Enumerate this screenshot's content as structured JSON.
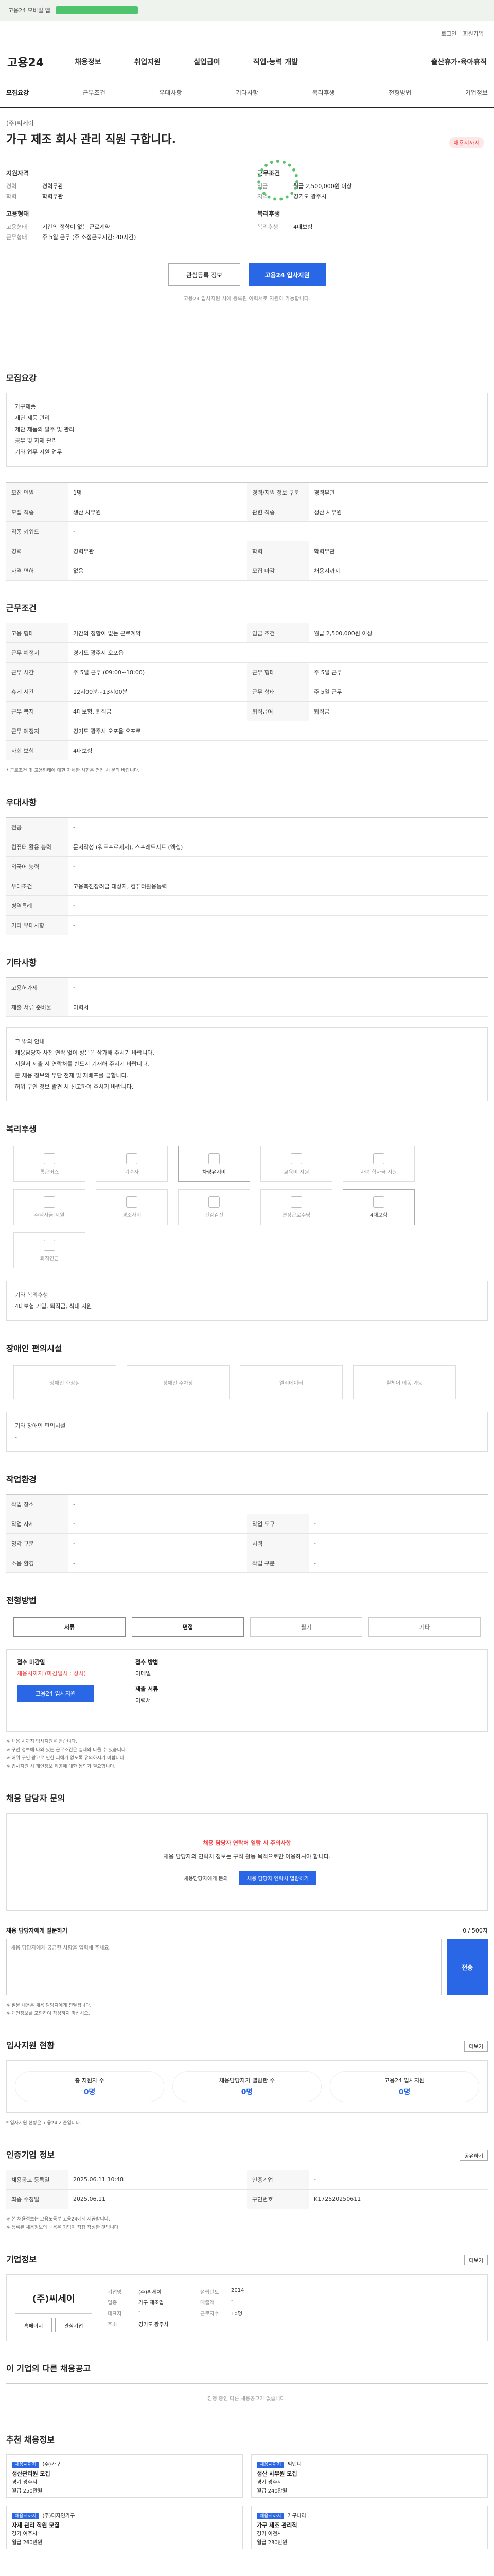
{
  "top": {
    "banner_text": "고용24 모바일 앱",
    "bar_label": "앱 다운로드"
  },
  "util": {
    "login": "로그인",
    "signup": "회원가입"
  },
  "gnb": {
    "logo": "고용24",
    "menu": [
      "채용정보",
      "취업지원",
      "실업급여",
      "직업·능력 개발"
    ],
    "right": "출산휴가·육아휴직"
  },
  "tabs": [
    "모집요강",
    "근무조건",
    "우대사항",
    "기타사항",
    "복리후생",
    "전형방법",
    "기업정보"
  ],
  "job": {
    "company": "(주)씨세이",
    "title": "가구 제조 회사 관리 직원 구합니다.",
    "dday": "채용시까지",
    "left_title": "지원자격",
    "left_rows": [
      [
        "경력",
        "경력무관"
      ],
      [
        "학력",
        "학력무관"
      ]
    ],
    "left_title2": "고용형태",
    "left_rows2": [
      [
        "고용형태",
        "기간의 정함이 없는 근로계약"
      ],
      [
        "근무형태",
        "주 5일 근무 (주 소정근로시간: 40시간)"
      ]
    ],
    "right_title": "근무조건",
    "right_rows": [
      [
        "임금",
        "월급 2,500,000원 이상"
      ],
      [
        "지역",
        "경기도 광주시"
      ]
    ],
    "right_title2": "복리후생",
    "right_rows2": [
      [
        "복리후생",
        "4대보험"
      ]
    ],
    "btn_save": "관심등록 정보",
    "btn_apply": "고용24 입사지원",
    "note": "고용24 입사지원 시에 등록된 이력서로 지원이 가능합니다."
  },
  "recruit": {
    "h": "모집요강",
    "desc": [
      "가구제품",
      "재단 제품 관리",
      "제단 제품의 발주 및 관리",
      "공무 및 자재 관리",
      "기타 업무 지원 업무"
    ],
    "rows": [
      [
        "모집 인원",
        "1명",
        "경력/지원 정보 구분",
        "경력무관"
      ],
      [
        "모집 직종",
        "생산 사무원",
        "관련 직종",
        "생산 사무원"
      ],
      [
        "직종 키워드",
        "-",
        "",
        ""
      ],
      [
        "경력",
        "경력무관",
        "학력",
        "학력무관"
      ],
      [
        "자격 면허",
        "없음",
        "모집 마감",
        "채용시까지"
      ]
    ]
  },
  "work": {
    "h": "근무조건",
    "rows": [
      [
        "고용 형태",
        "기간의 정함이 없는 근로계약",
        "임금 조건",
        "월급 2,500,000원 이상"
      ],
      [
        "근무 예정지",
        "경기도 광주시 오포읍",
        "",
        ""
      ],
      [
        "근무 시간",
        "주 5일 근무 (09:00~18:00)",
        "근무 형태",
        "주 5일 근무"
      ],
      [
        "휴게 시간",
        "12시00분~13시00분",
        "근무 형태",
        "주 5일 근무"
      ],
      [
        "근무 복지",
        "4대보험, 퇴직금",
        "퇴직급여",
        "퇴직금"
      ],
      [
        "근무 예정지",
        "경기도 광주시 오포읍 오포로",
        "",
        ""
      ],
      [
        "사회 보험",
        "4대보험",
        "",
        ""
      ]
    ],
    "note": "* 근로조건 및 고용형태에 대한 자세한 사항은 면접 시 문의 바랍니다."
  },
  "prefer": {
    "h": "우대사항",
    "rows": [
      [
        "전공",
        "-"
      ],
      [
        "컴퓨터 활용 능력",
        "문서작성 (워드프로세서), 스프레드시트 (엑셀)"
      ],
      [
        "외국어 능력",
        "-"
      ],
      [
        "우대조건",
        "고용촉진장려금 대상자, 컴퓨터활용능력"
      ],
      [
        "병역특례",
        "-"
      ],
      [
        "기타 우대사항",
        "-"
      ]
    ]
  },
  "etc": {
    "h": "기타사항",
    "rows": [
      [
        "고용허가제",
        "-"
      ],
      [
        "제출 서류 준비물",
        "이력서"
      ]
    ],
    "notice_title": "그 밖의 안내",
    "notice": [
      "채용담당자 사전 연락 없이 방문은 삼가해 주시기 바랍니다.",
      "지원서 제출 시 연락처를 반드시 기재해 주시기 바랍니다.",
      "본 채용 정보의 무단 전재 및 재배포를 금합니다.",
      "허위 구인 정보 발견 시 신고하여 주시기 바랍니다."
    ]
  },
  "welfare": {
    "h": "복리후생",
    "items": [
      "통근버스",
      "기숙사",
      "차량유지비",
      "교육비 지원",
      "자녀 학자금 지원",
      "주택자금 지원",
      "경조사비",
      "건강검진",
      "연장근로수당",
      "4대보험",
      "퇴직연금"
    ],
    "on": [
      2,
      9
    ],
    "other_title": "기타 복리후생",
    "other": "4대보험 가입, 퇴직금, 식대 지원"
  },
  "disab": {
    "h": "장애인 편의시설",
    "items": [
      "장애인 화장실",
      "장애인 주차장",
      "엘리베이터",
      "휠체어 이동 가능"
    ],
    "other_title": "기타 장애인 편의시설",
    "other": "-"
  },
  "env": {
    "h": "작업환경",
    "rows": [
      [
        "작업 장소",
        "-",
        "",
        ""
      ],
      [
        "작업 자세",
        "-",
        "작업 도구",
        "-"
      ],
      [
        "청각 구분",
        "-",
        "시력",
        "-"
      ],
      [
        "소음 환경",
        "-",
        "작업 구분",
        "-"
      ]
    ]
  },
  "screen": {
    "h": "전형방법",
    "ways": [
      "서류",
      "면접",
      "필기",
      "기타"
    ],
    "on": [
      0,
      1
    ],
    "label1": "접수 마감일",
    "val1": "채용시까지 (마감일시 : 상시)",
    "label2": "접수 방법",
    "val2": "이메일",
    "label3": "제출 서류",
    "val3": "이력서",
    "apply_btn": "고용24 입사지원",
    "bullets": [
      "※ 채용 시까지 입사지원을 받습니다.",
      "※ 구인 정보에 나와 있는 근무조건은 실제와 다를 수 있습니다.",
      "※ 허위 구인 광고로 인한 피해가 없도록 유의하시기 바랍니다.",
      "※ 입사지원 시 개인정보 제공에 대한 동의가 필요합니다."
    ]
  },
  "inquiry": {
    "h": "채용 담당자 문의",
    "warn_title": "채용 담당자 연락처 열람 시 주의사항",
    "warn_text": "채용 담당자의 연락처 정보는 구직 활동 목적으로만 이용하셔야 합니다.",
    "btn1": "채용담당자에게 문의",
    "btn2": "채용 담당자 연락처 열람하기",
    "box_title": "채용 담당자에게 질문하기",
    "count": "0 / 500자",
    "placeholder": "채용 담당자에게 궁금한 사항을 입력해 주세요.",
    "send": "전송",
    "bullets": [
      "※ 질문 내용은 채용 담당자에게 전달됩니다.",
      "※ 개인정보를 포함하여 작성하지 마십시오."
    ]
  },
  "status": {
    "h": "입사지원 현황",
    "more": "더보기",
    "items": [
      [
        "총 지원자 수",
        "0명"
      ],
      [
        "채용담당자가 열람한 수",
        "0명"
      ],
      [
        "고용24 입사지원",
        "0명"
      ]
    ],
    "note": "* 입사지원 현황은 고용24 기준입니다."
  },
  "reginfo": {
    "h": "인증기업 정보",
    "share": "공유하기",
    "rows": [
      [
        "채용공고 등록일",
        "2025.06.11 10:48",
        "인증기업",
        "-"
      ],
      [
        "최종 수정일",
        "2025.06.11",
        "구인번호",
        "K172520250611"
      ]
    ],
    "notes": [
      "※ 본 채용정보는 고용노동부 고용24에서 제공합니다.",
      "※ 등록된 채용정보의 내용은 기업이 직접 작성한 것입니다."
    ]
  },
  "corp": {
    "h": "기업정보",
    "more": "더보기",
    "name": "(주)씨세이",
    "rows": [
      [
        "기업명",
        "(주)씨세이",
        "설립년도",
        "2014"
      ],
      [
        "업종",
        "가구 제조업",
        "매출액",
        "-"
      ],
      [
        "대표자",
        "-",
        "근로자수",
        "10명"
      ],
      [
        "주소",
        "경기도 광주시",
        "",
        ""
      ]
    ],
    "b1": "홈페이지",
    "b2": "관심기업"
  },
  "same": {
    "h": "이 기업의 다른 채용공고",
    "empty": "진행 중인 다른 채용공고가 없습니다."
  },
  "recommend": {
    "h": "추천 채용정보",
    "cards": [
      [
        "채용시까지",
        "(주)가구",
        "생산관리원 모집",
        "경기 광주시",
        "월급 250만원"
      ],
      [
        "채용시까지",
        "씨앤디",
        "생산 사무원 모집",
        "경기 광주시",
        "월급 240만원"
      ],
      [
        "채용시까지",
        "(주)디자인가구",
        "자재 관리 직원 모집",
        "경기 여주시",
        "월급 260만원"
      ],
      [
        "채용시까지",
        "가구나라",
        "가구 제조 관리직",
        "경기 이천시",
        "월급 230만원"
      ]
    ]
  }
}
